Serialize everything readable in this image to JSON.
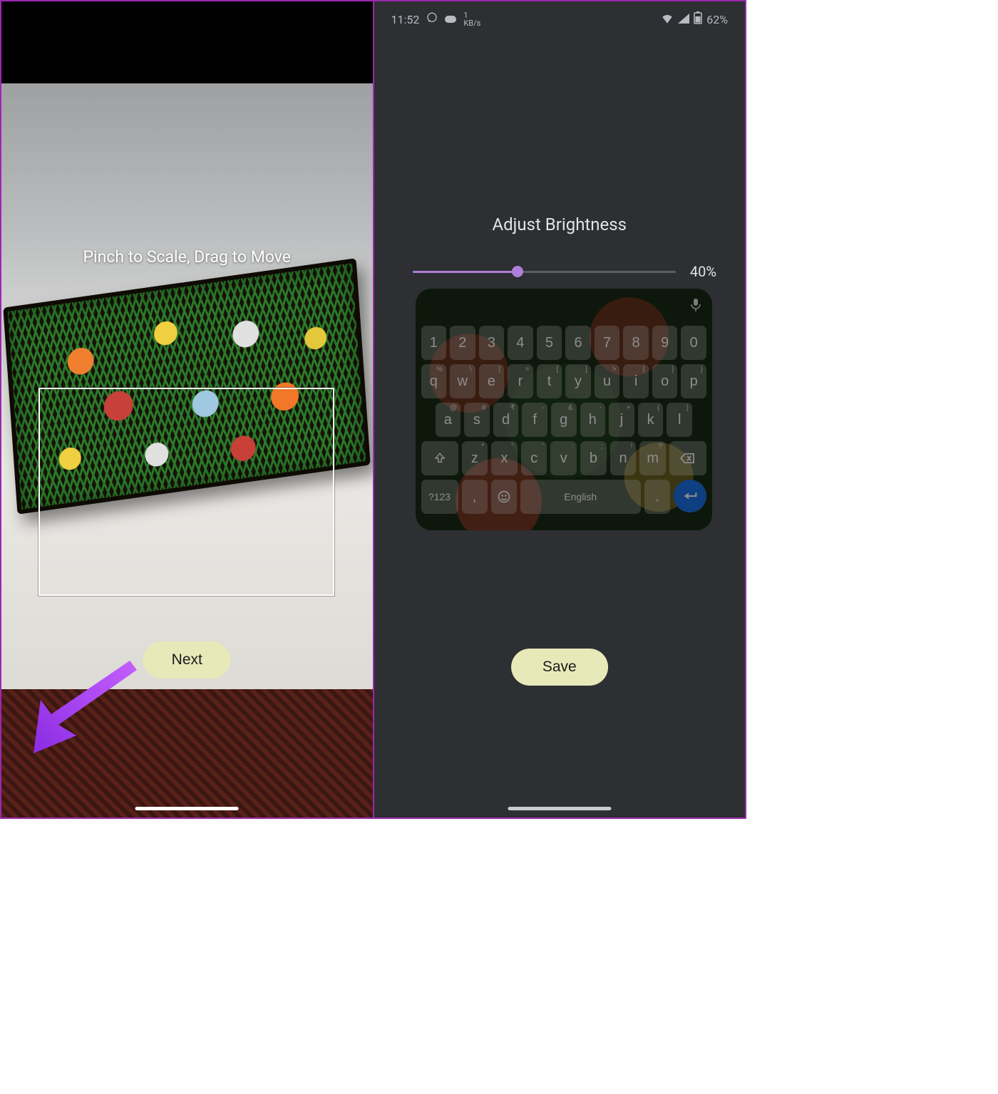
{
  "left": {
    "instruction": "Pinch to Scale, Drag to Move",
    "next_label": "Next"
  },
  "right": {
    "statusbar": {
      "time": "11:52",
      "net_speed_value": "1",
      "net_speed_unit": "KB/s",
      "battery": "62%"
    },
    "title": "Adjust Brightness",
    "brightness_value": "40%",
    "save_label": "Save",
    "keyboard": {
      "language": "English",
      "sym_label": "?123",
      "row_num": [
        "1",
        "2",
        "3",
        "4",
        "5",
        "6",
        "7",
        "8",
        "9",
        "0"
      ],
      "row_top": [
        "q",
        "w",
        "e",
        "r",
        "t",
        "y",
        "u",
        "i",
        "o",
        "p"
      ],
      "row_top_sup": [
        "%",
        "\\",
        "|",
        "=",
        "[",
        "]",
        ">",
        "{",
        "}",
        ""
      ],
      "row_top_sup_wrap": {
        "p": "}"
      },
      "row_home": [
        "a",
        "s",
        "d",
        "f",
        "g",
        "h",
        "j",
        "k",
        "l"
      ],
      "row_home_sup": [
        "@",
        "#",
        "₹",
        "-",
        "&",
        "-",
        "+",
        "(",
        ")"
      ],
      "row_bottom": [
        "z",
        "x",
        "c",
        "v",
        "b",
        "n",
        "m"
      ],
      "row_bottom_sup": [
        "*",
        "\"",
        "'",
        ":",
        ";",
        "!",
        "?"
      ]
    }
  }
}
